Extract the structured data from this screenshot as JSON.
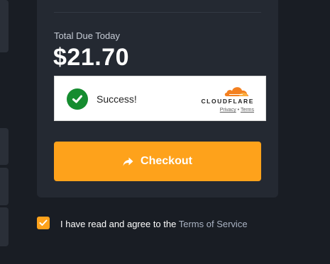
{
  "summary": {
    "total_label": "Total Due Today",
    "total_amount": "$21.70"
  },
  "captcha": {
    "status_text": "Success!",
    "brand": "CLOUDFLARE",
    "privacy_link": "Privacy",
    "separator": "•",
    "terms_link": "Terms",
    "logo_icon": "cloudflare-cloud-icon",
    "status_icon": "check-circle-icon",
    "status_color": "#158c2f"
  },
  "checkout": {
    "label": "Checkout",
    "icon": "share-arrow-icon",
    "color": "#fea21b"
  },
  "agreement": {
    "checked": true,
    "text": "I have read and agree to the",
    "link": "Terms of Service"
  }
}
